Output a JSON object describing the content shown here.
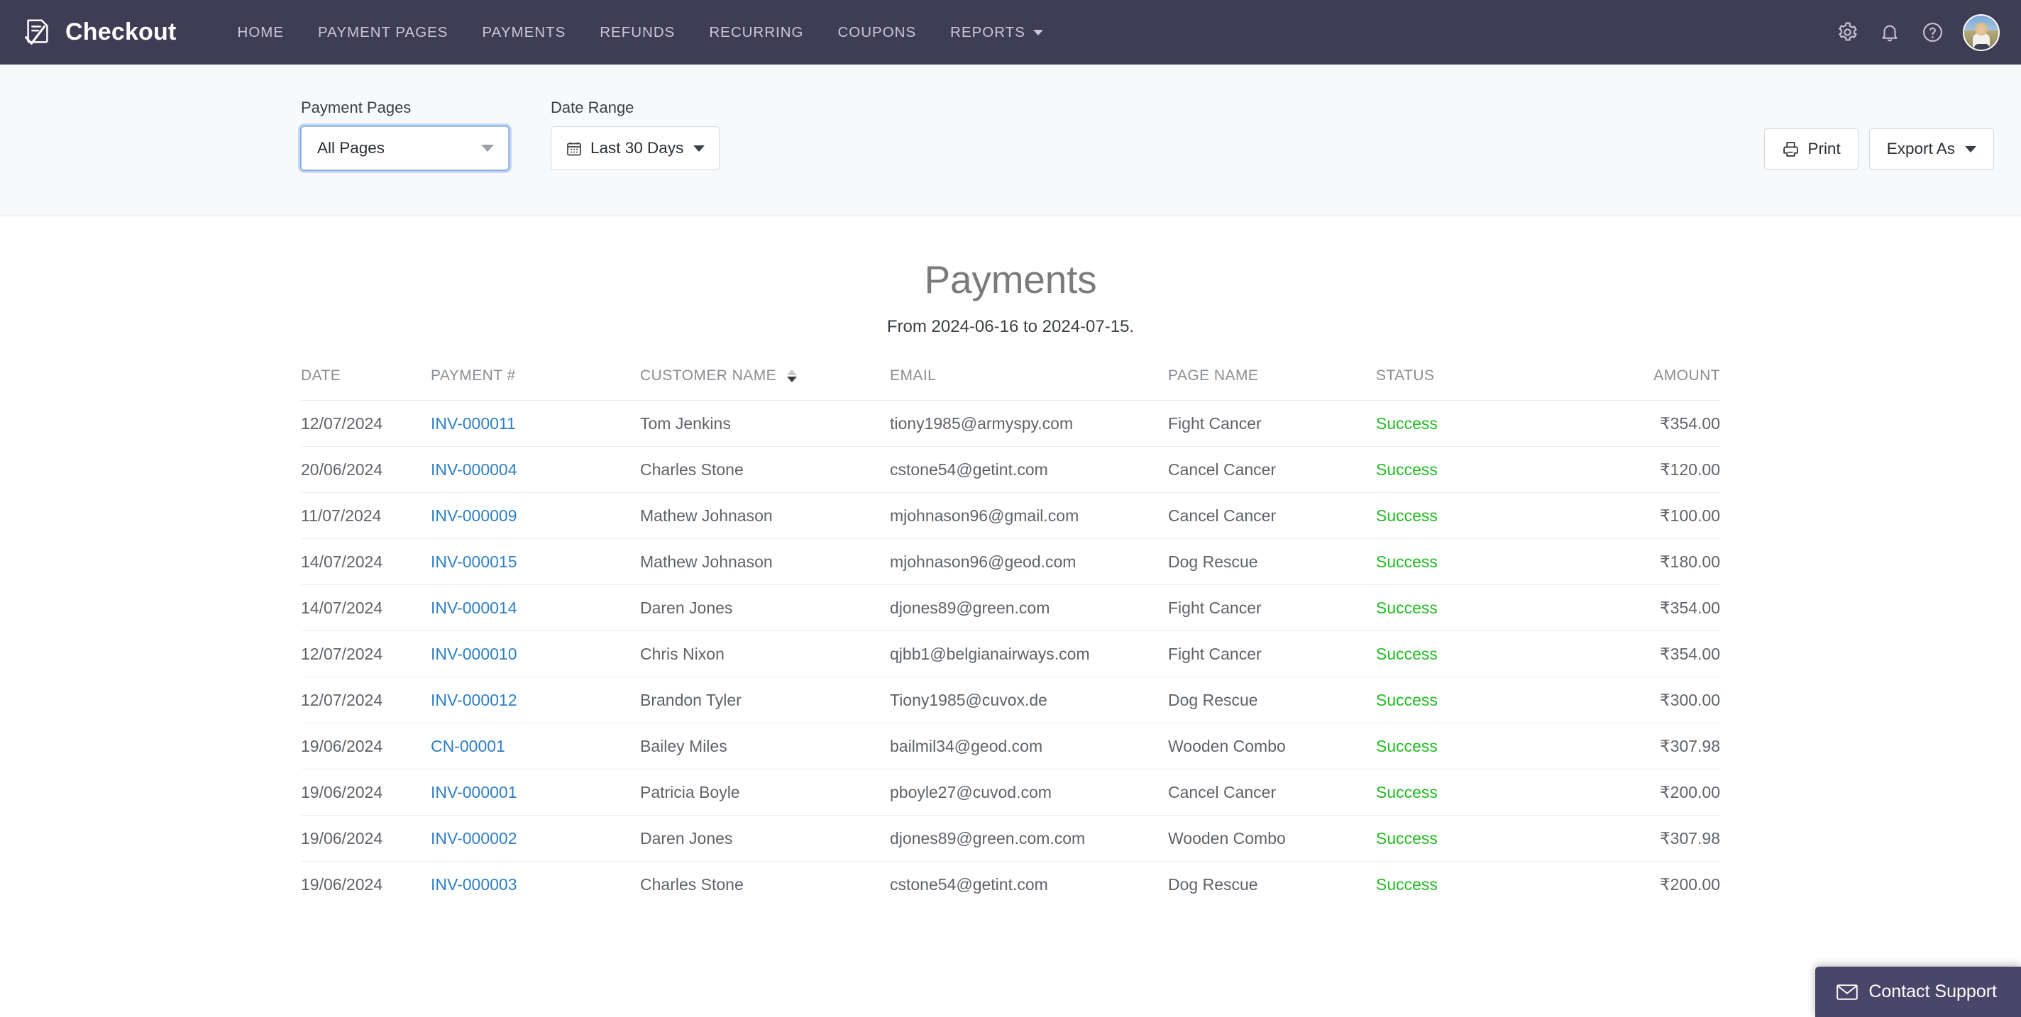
{
  "navbar": {
    "brand": "Checkout",
    "brand_logo_icon": "checkout-document-check-icon",
    "links": [
      {
        "label": "HOME",
        "has_caret": false
      },
      {
        "label": "PAYMENT PAGES",
        "has_caret": false
      },
      {
        "label": "PAYMENTS",
        "has_caret": false
      },
      {
        "label": "REFUNDS",
        "has_caret": false
      },
      {
        "label": "RECURRING",
        "has_caret": false
      },
      {
        "label": "COUPONS",
        "has_caret": false
      },
      {
        "label": "REPORTS",
        "has_caret": true
      }
    ],
    "icons": [
      "gear-icon",
      "bell-icon",
      "help-circle-icon"
    ],
    "avatar_alt": "user-avatar"
  },
  "filters": {
    "payment_pages_label": "Payment Pages",
    "payment_pages_value": "All Pages",
    "date_range_label": "Date Range",
    "date_range_value": "Last 30 Days",
    "print_label": "Print",
    "export_label": "Export As"
  },
  "page": {
    "title": "Payments",
    "subtitle": "From 2024-06-16 to 2024-07-15."
  },
  "table": {
    "columns": [
      {
        "key": "date",
        "label": "DATE",
        "align": "left",
        "sortable": false
      },
      {
        "key": "payment",
        "label": "PAYMENT #",
        "align": "left",
        "sortable": false
      },
      {
        "key": "name",
        "label": "CUSTOMER NAME",
        "align": "left",
        "sortable": true,
        "sort_state": "desc"
      },
      {
        "key": "email",
        "label": "EMAIL",
        "align": "left",
        "sortable": false
      },
      {
        "key": "pageName",
        "label": "PAGE NAME",
        "align": "left",
        "sortable": false
      },
      {
        "key": "status",
        "label": "STATUS",
        "align": "left",
        "sortable": false
      },
      {
        "key": "amount",
        "label": "AMOUNT",
        "align": "right",
        "sortable": false
      }
    ],
    "rows": [
      {
        "date": "12/07/2024",
        "payment": "INV-000011",
        "name": "Tom Jenkins",
        "email": "tiony1985@armyspy.com",
        "pageName": "Fight Cancer",
        "status": "Success",
        "amount": "₹354.00"
      },
      {
        "date": "20/06/2024",
        "payment": "INV-000004",
        "name": "Charles Stone",
        "email": "cstone54@getint.com",
        "pageName": "Cancel Cancer",
        "status": "Success",
        "amount": "₹120.00"
      },
      {
        "date": "11/07/2024",
        "payment": "INV-000009",
        "name": "Mathew Johnason",
        "email": "mjohnason96@gmail.com",
        "pageName": "Cancel Cancer",
        "status": "Success",
        "amount": "₹100.00"
      },
      {
        "date": "14/07/2024",
        "payment": "INV-000015",
        "name": "Mathew Johnason",
        "email": "mjohnason96@geod.com",
        "pageName": "Dog Rescue",
        "status": "Success",
        "amount": "₹180.00"
      },
      {
        "date": "14/07/2024",
        "payment": "INV-000014",
        "name": "Daren Jones",
        "email": "djones89@green.com",
        "pageName": "Fight Cancer",
        "status": "Success",
        "amount": "₹354.00"
      },
      {
        "date": "12/07/2024",
        "payment": "INV-000010",
        "name": "Chris Nixon",
        "email": "qjbb1@belgianairways.com",
        "pageName": "Fight Cancer",
        "status": "Success",
        "amount": "₹354.00"
      },
      {
        "date": "12/07/2024",
        "payment": "INV-000012",
        "name": "Brandon Tyler",
        "email": "Tiony1985@cuvox.de",
        "pageName": "Dog Rescue",
        "status": "Success",
        "amount": "₹300.00"
      },
      {
        "date": "19/06/2024",
        "payment": "CN-00001",
        "name": "Bailey Miles",
        "email": "bailmil34@geod.com",
        "pageName": "Wooden Combo",
        "status": "Success",
        "amount": "₹307.98"
      },
      {
        "date": "19/06/2024",
        "payment": "INV-000001",
        "name": "Patricia Boyle",
        "email": "pboyle27@cuvod.com",
        "pageName": "Cancel Cancer",
        "status": "Success",
        "amount": "₹200.00"
      },
      {
        "date": "19/06/2024",
        "payment": "INV-000002",
        "name": "Daren Jones",
        "email": "djones89@green.com.com",
        "pageName": "Wooden Combo",
        "status": "Success",
        "amount": "₹307.98"
      },
      {
        "date": "19/06/2024",
        "payment": "INV-000003",
        "name": "Charles Stone",
        "email": "cstone54@getint.com",
        "pageName": "Dog Rescue",
        "status": "Success",
        "amount": "₹200.00"
      }
    ]
  },
  "support": {
    "label": "Contact Support",
    "icon": "envelope-icon"
  },
  "colors": {
    "navbar_bg": "#3f3d56",
    "filterbar_bg": "#f8f9fa",
    "link_blue": "#2e7fc4",
    "success_green": "#22bb22",
    "support_bg": "#4a4669",
    "focus_blue": "#6fa8f5"
  }
}
